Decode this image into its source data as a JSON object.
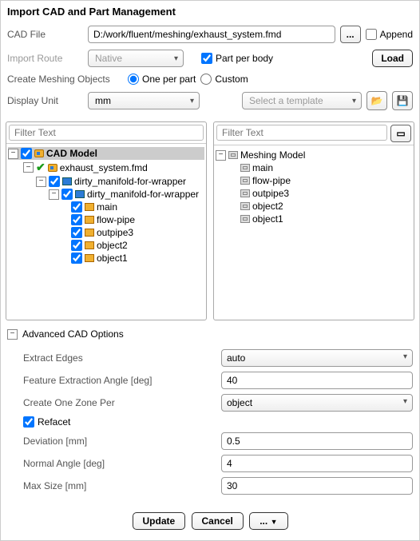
{
  "title": "Import CAD and Part Management",
  "cadFile": {
    "label": "CAD File",
    "value": "D:/work/fluent/meshing/exhaust_system.fmd",
    "browse": "...",
    "appendLabel": "Append"
  },
  "importRoute": {
    "label": "Import Route",
    "value": "Native",
    "partPerBody": "Part per body",
    "loadLabel": "Load"
  },
  "meshingObjects": {
    "label": "Create Meshing Objects",
    "opt1": "One per part",
    "opt2": "Custom"
  },
  "displayUnit": {
    "label": "Display Unit",
    "value": "mm",
    "templatePlaceholder": "Select a template"
  },
  "leftTree": {
    "filterPlaceholder": "Filter Text",
    "root": "CAD Model",
    "file": "exhaust_system.fmd",
    "assembly1": "dirty_manifold-for-wrapper",
    "assembly2": "dirty_manifold-for-wrapper",
    "bodies": [
      "main",
      "flow-pipe",
      "outpipe3",
      "object2",
      "object1"
    ]
  },
  "rightTree": {
    "filterPlaceholder": "Filter Text",
    "root": "Meshing Model",
    "items": [
      "main",
      "flow-pipe",
      "outpipe3",
      "object2",
      "object1"
    ]
  },
  "advanced": {
    "title": "Advanced CAD Options",
    "extractEdges": {
      "label": "Extract Edges",
      "value": "auto"
    },
    "featureAngle": {
      "label": "Feature Extraction Angle [deg]",
      "value": "40"
    },
    "createOneZone": {
      "label": "Create One Zone Per",
      "value": "object"
    },
    "refacet": "Refacet",
    "deviation": {
      "label": "Deviation [mm]",
      "value": "0.5"
    },
    "normalAngle": {
      "label": "Normal Angle [deg]",
      "value": "4"
    },
    "maxSize": {
      "label": "Max Size [mm]",
      "value": "30"
    }
  },
  "footer": {
    "update": "Update",
    "cancel": "Cancel",
    "more": "..."
  }
}
